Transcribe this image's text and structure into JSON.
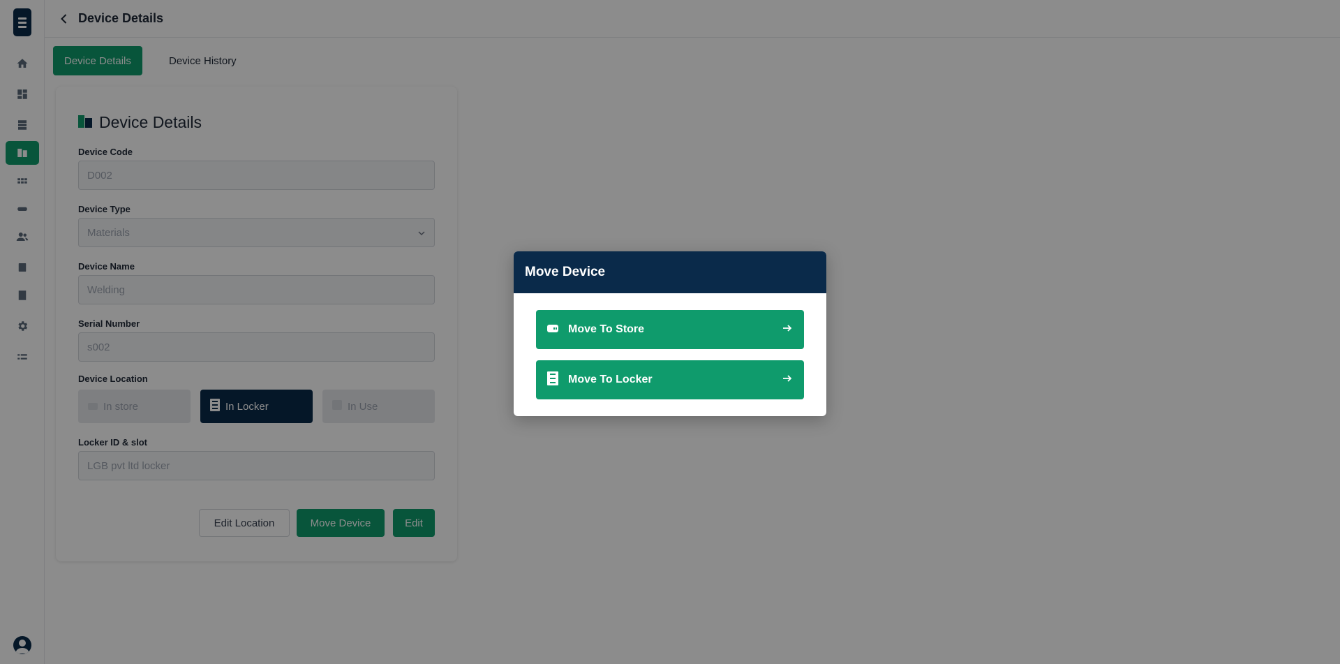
{
  "header": {
    "title": "Device Details"
  },
  "tabs": [
    {
      "label": "Device Details",
      "active": true
    },
    {
      "label": "Device History",
      "active": false
    }
  ],
  "sidebar": {
    "icons": [
      "home-icon",
      "dashboard-icon",
      "inventory-icon",
      "devices-icon",
      "grid-icon",
      "badge-icon",
      "users-icon",
      "building-icon",
      "reports-icon",
      "gear-icon",
      "list-icon"
    ],
    "active_index": 3
  },
  "card": {
    "title": "Device Details",
    "fields": [
      {
        "label": "Device Code",
        "value": "D002"
      },
      {
        "label": "Device Type",
        "value": "Materials"
      },
      {
        "label": "Device Name",
        "value": "Welding"
      },
      {
        "label": "Serial Number",
        "value": "s002"
      }
    ],
    "location_label": "Device Location",
    "locations": [
      {
        "label": "In store",
        "selected": false
      },
      {
        "label": "In Locker",
        "selected": true
      },
      {
        "label": "In Use",
        "selected": false
      }
    ],
    "locker_label": "Locker ID & slot",
    "locker_value": "LGB pvt ltd locker",
    "buttons": {
      "edit_location": "Edit Location",
      "move_device": "Move Device",
      "edit": "Edit"
    }
  },
  "modal": {
    "title": "Move Device",
    "options": [
      {
        "label": "Move To Store",
        "icon": "store-icon"
      },
      {
        "label": "Move To Locker",
        "icon": "locker-icon"
      }
    ]
  },
  "colors": {
    "primary": "#0f9b6c",
    "navy": "#0a2a4a",
    "overlay": "rgba(0,0,0,0.45)"
  }
}
